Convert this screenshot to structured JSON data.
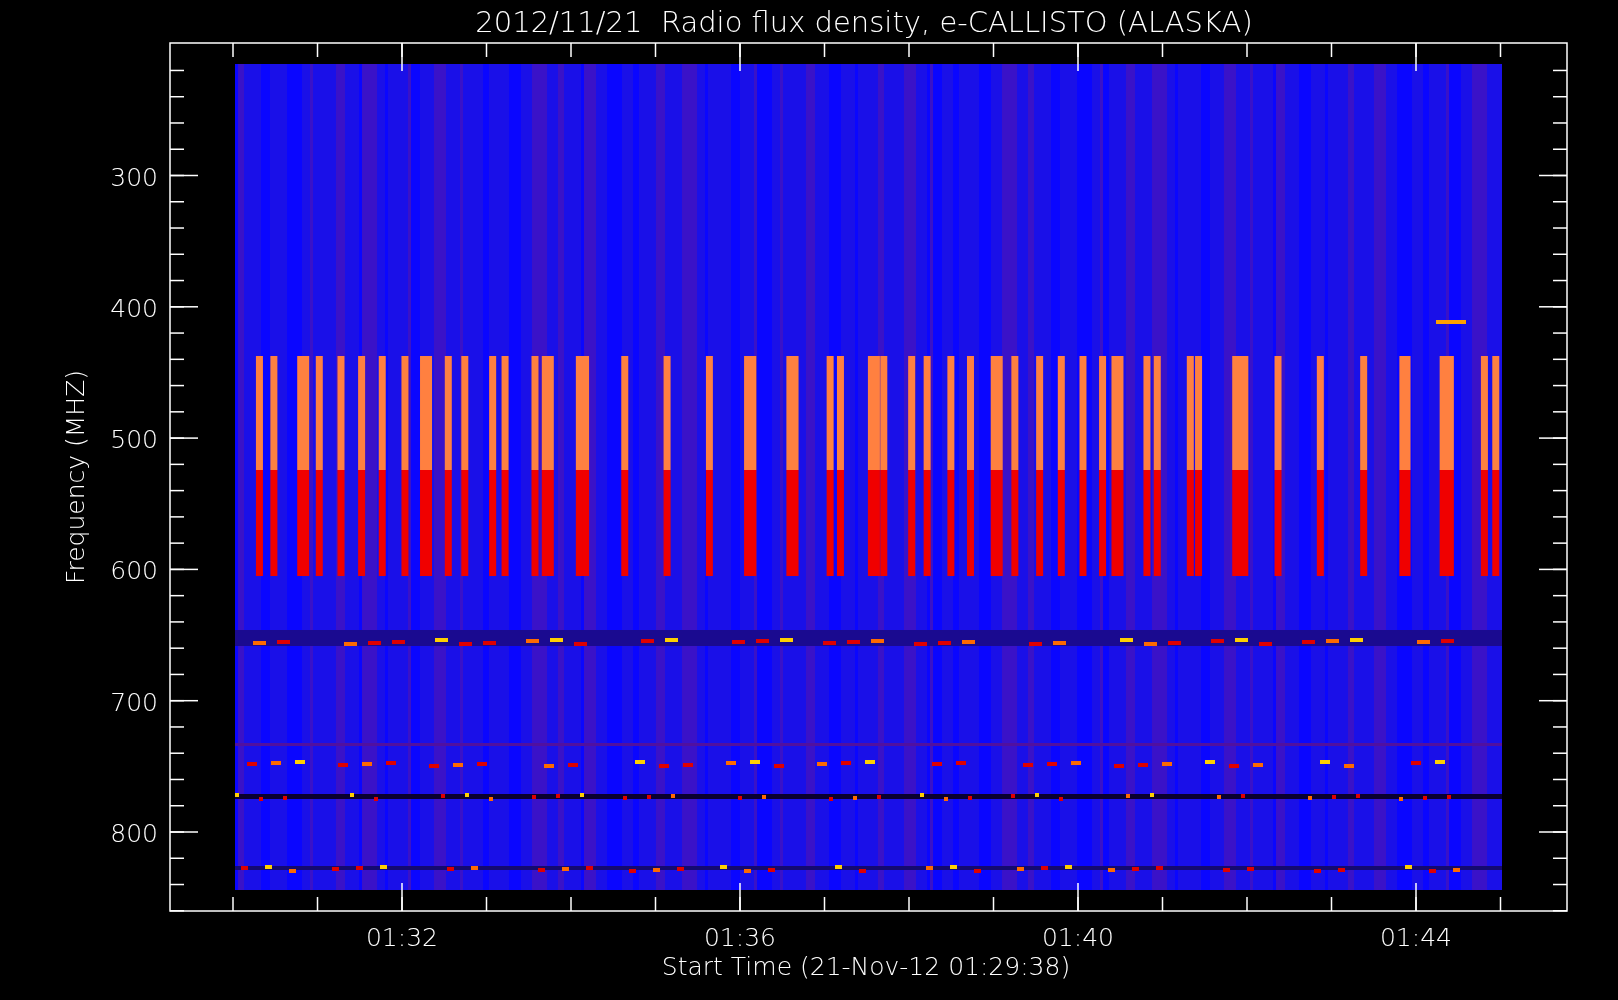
{
  "title": "2012/11/21  Radio flux density, e-CALLISTO (ALASKA)",
  "y_axis": {
    "label": "Frequency (MHZ)",
    "ticks": [
      "300",
      "400",
      "500",
      "600",
      "700",
      "800"
    ]
  },
  "x_axis": {
    "label": "Start Time (21-Nov-12 01:29:38)",
    "ticks": [
      "01:32",
      "01:36",
      "01:40",
      "01:44"
    ]
  }
}
